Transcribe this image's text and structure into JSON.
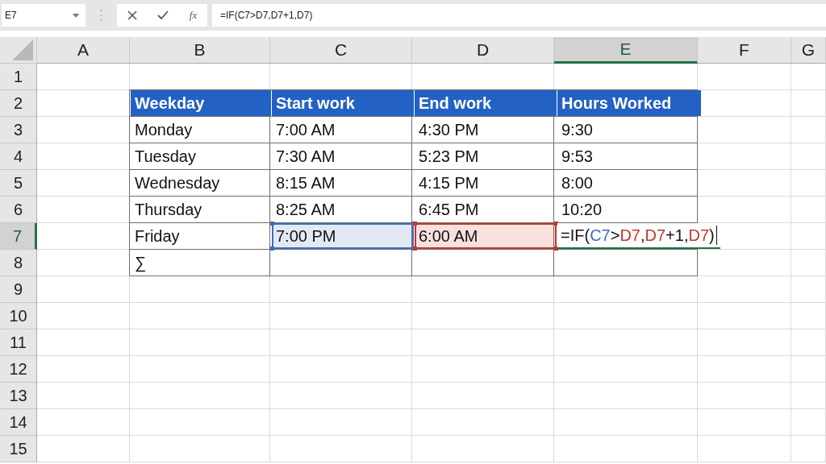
{
  "name_box": {
    "value": "E7"
  },
  "formula_bar": {
    "function_label": "fx",
    "value": "=IF(C7>D7,D7+1,D7)"
  },
  "columns": [
    {
      "label": "A",
      "selected": false
    },
    {
      "label": "B",
      "selected": false
    },
    {
      "label": "C",
      "selected": false
    },
    {
      "label": "D",
      "selected": false
    },
    {
      "label": "E",
      "selected": true
    },
    {
      "label": "F",
      "selected": false
    },
    {
      "label": "G",
      "selected": false
    }
  ],
  "rows": [
    {
      "label": "1",
      "selected": false
    },
    {
      "label": "2",
      "selected": false
    },
    {
      "label": "3",
      "selected": false
    },
    {
      "label": "4",
      "selected": false
    },
    {
      "label": "5",
      "selected": false
    },
    {
      "label": "6",
      "selected": false
    },
    {
      "label": "7",
      "selected": true
    },
    {
      "label": "8",
      "selected": false
    },
    {
      "label": "9",
      "selected": false
    },
    {
      "label": "10",
      "selected": false
    },
    {
      "label": "11",
      "selected": false
    },
    {
      "label": "12",
      "selected": false
    },
    {
      "label": "13",
      "selected": false
    },
    {
      "label": "14",
      "selected": false
    },
    {
      "label": "15",
      "selected": false
    }
  ],
  "table": {
    "header": [
      "Weekday",
      "Start work",
      "End work",
      "Hours Worked"
    ],
    "rows": [
      [
        {
          "text": "Monday"
        },
        {
          "text": "7:00 AM"
        },
        {
          "text": "4:30 PM"
        },
        {
          "text": "9:30"
        }
      ],
      [
        {
          "text": "Tuesday"
        },
        {
          "text": "7:30 AM"
        },
        {
          "text": "5:23 PM"
        },
        {
          "text": "9:53"
        }
      ],
      [
        {
          "text": "Wednesday"
        },
        {
          "text": "8:15 AM"
        },
        {
          "text": "4:15 PM"
        },
        {
          "text": "8:00"
        }
      ],
      [
        {
          "text": "Thursday"
        },
        {
          "text": "8:25 AM"
        },
        {
          "text": "6:45 PM"
        },
        {
          "text": "10:20"
        }
      ],
      [
        {
          "text": "Friday"
        },
        {
          "text": "7:00 PM",
          "kind": "reference",
          "color": "#3c6ebf"
        },
        {
          "text": "6:00 AM",
          "kind": "reference",
          "color": "#c0392b"
        },
        {
          "kind": "editing",
          "parts": [
            {
              "text": "=IF("
            },
            {
              "text": "C7",
              "color": "#3c6ebf"
            },
            {
              "text": ">"
            },
            {
              "text": "D7",
              "color": "#c0392b"
            },
            {
              "text": ","
            },
            {
              "text": "D7",
              "color": "#c0392b"
            },
            {
              "text": "+1,"
            },
            {
              "text": "D7",
              "color": "#c0392b"
            },
            {
              "text": ")"
            }
          ]
        }
      ],
      [
        {
          "text": "∑"
        }
      ]
    ]
  }
}
